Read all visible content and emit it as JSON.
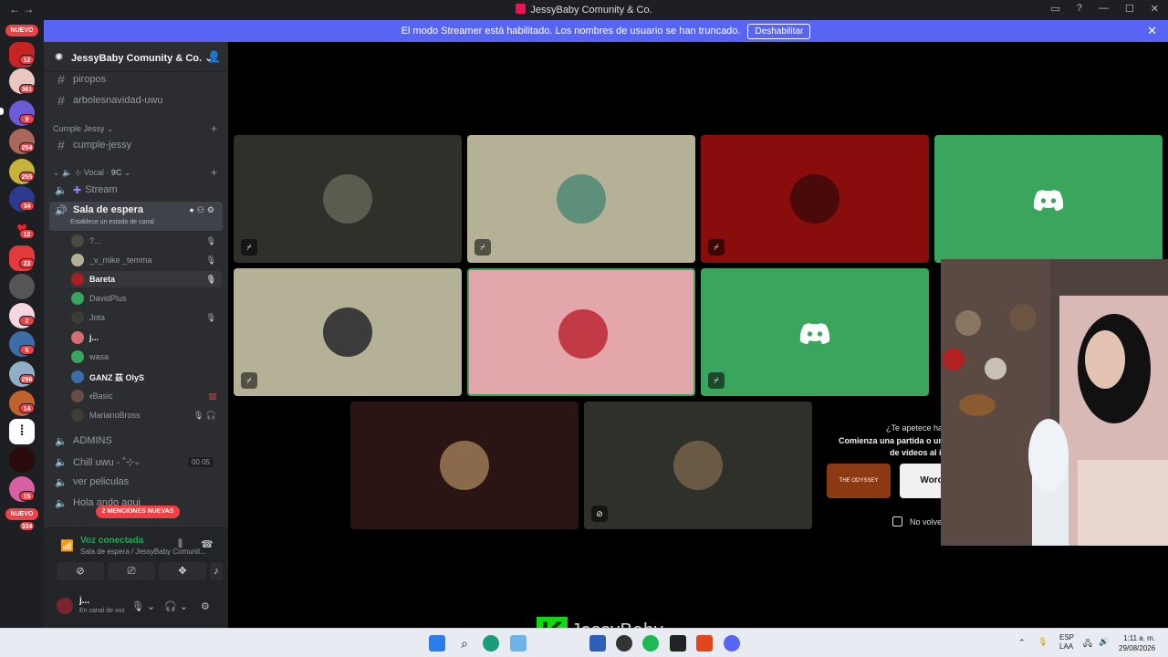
{
  "window": {
    "title": "JessyBaby Comunity & Co.",
    "nav_glyphs": "← →",
    "controls": [
      "▭",
      "?",
      "—",
      "☐",
      "✕"
    ]
  },
  "banner": {
    "message": "El modo Streamer está habilitado. Los nombres de usuario se han truncado.",
    "button": "Deshabilitar"
  },
  "rail": {
    "new_label": "NUEVO",
    "badges": [
      "12",
      "361",
      "9",
      "254",
      "255",
      "34",
      "12",
      "23",
      "2",
      "5",
      "296",
      "14",
      "15"
    ],
    "bottom_new_label": "NUEVO",
    "bottom_badge": "334"
  },
  "sidebar": {
    "guild_name": "JessyBaby Comunity & Co.",
    "channels_top": [
      "piropos",
      "arbolesnavidad-uwu"
    ],
    "category_cumple": "Cumple Jessy",
    "channel_cumple": "cumple-jessy",
    "category_vocal": "⊹ Vocal · 𝟗𝐂",
    "voice_stream": "Stream",
    "voice_current": "Sala de espera",
    "voice_current_status": "Establece un estado de canal",
    "users": [
      "?...",
      "_v_mike _temma",
      "Bareta",
      "DavidPlus",
      "Jota",
      "j...",
      "wasa",
      "GANZ 茲  OlyS",
      "𝖊Basic",
      "MarianoBross"
    ],
    "voice_admins": "ADMINS",
    "voice_chill": "Chill uwu - ˚⊹₊",
    "chill_counts": [
      "00",
      "05"
    ],
    "voice_movies": "ver peliculas",
    "voice_hola": "Hola ando aqui",
    "mentions_label": "2 MENCIONES NUEVAS"
  },
  "voice_panel": {
    "title": "Voz conectada",
    "subtitle": "Sala de espera / JessyBaby Comunit...",
    "me_name": "j...",
    "me_status": "En canal de voz"
  },
  "activity": {
    "title": "¿Te apetece ha",
    "line1": "Comienza una partida o una",
    "line2": "de vídeos al i",
    "card1": "THE ODYSSEY",
    "card2": "Word",
    "checkbox_label": "No volver"
  },
  "taskbar": {
    "lang1": "ESP",
    "lang2": "LAA",
    "time": "1:11 a. m.",
    "date": "29/08/2026",
    "watermark": "JessyBaby",
    "watermark_k": "K"
  },
  "colors": {
    "blurple": "#5865f2",
    "green": "#23a55a",
    "red": "#f23f43",
    "discord_green_tile": "#3aa55d",
    "red_tile": "#8a0d0d",
    "pink_tile": "#e3a6aa",
    "khaki_tile": "#b5b197"
  }
}
